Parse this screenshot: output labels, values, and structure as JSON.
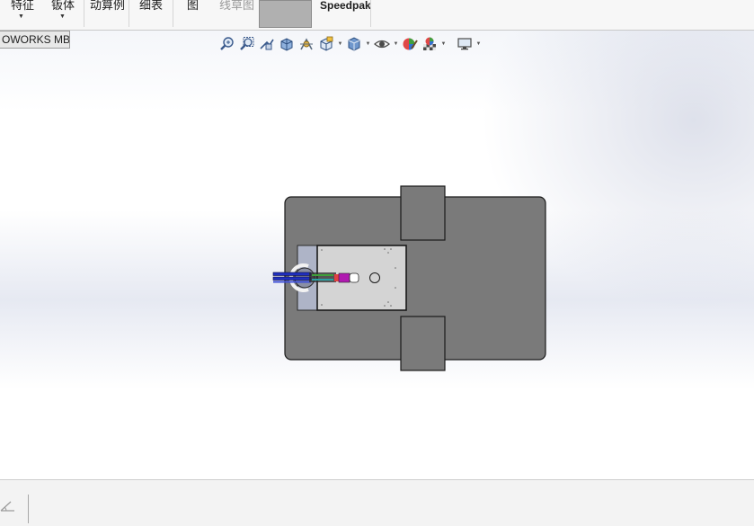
{
  "ribbon": {
    "items": [
      {
        "label": "特征",
        "has_arrow": true
      },
      {
        "label": "钣体",
        "has_arrow": true
      },
      {
        "label": "动算例",
        "has_arrow": false
      },
      {
        "label": "细表",
        "has_arrow": false
      },
      {
        "label": "图",
        "has_arrow": false
      },
      {
        "label": "线草图",
        "has_arrow": false,
        "disabled": true
      },
      {
        "label": "Speedpak",
        "has_arrow": false
      }
    ]
  },
  "tabs": {
    "active": "OWORKS MBD"
  },
  "hud_toolbar": {
    "icons": [
      "zoom-to-fit-icon",
      "zoom-to-area-icon",
      "previous-view-icon",
      "section-view-icon",
      "dynamic-annotation-icon",
      "view-orientation-icon",
      "display-style-icon",
      "hide-show-items-icon",
      "edit-appearance-icon",
      "apply-scene-icon",
      "view-settings-icon"
    ]
  },
  "colors": {
    "base_plate": "#7a7a7a",
    "inner_plate": "#d4d4d4",
    "bracket": "#aeb4c7",
    "ribbon_bg": "#f7f7f7",
    "actuator_blue": "#1f2fbf",
    "accent_magenta": "#b01ab0"
  }
}
